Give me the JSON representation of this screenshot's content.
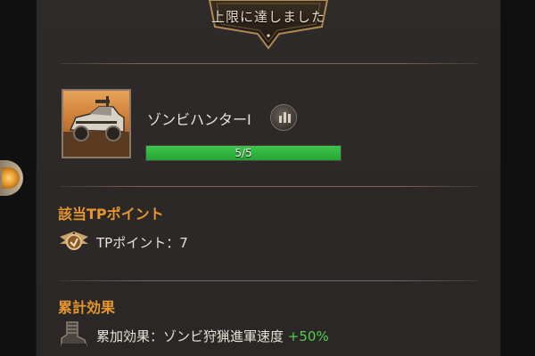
{
  "banner": {
    "text": "上限に達しました"
  },
  "skill": {
    "name": "ゾンビハンターⅠ",
    "progress_text": "5/5",
    "progress_fraction": 1.0,
    "icon": "armored-vehicle-image"
  },
  "tp_section": {
    "title": "該当TPポイント",
    "label": "TPポイント：",
    "value": "7",
    "icon": "winged-medal-icon"
  },
  "effect_section": {
    "title": "累計効果",
    "label": "累加効果：ゾンビ狩猟進軍速度",
    "bonus": "+50%",
    "icon": "boot-icon"
  },
  "colors": {
    "section_title": "#e7962e",
    "progress_fill": "#2fb23f",
    "bonus": "#4fd24a"
  }
}
